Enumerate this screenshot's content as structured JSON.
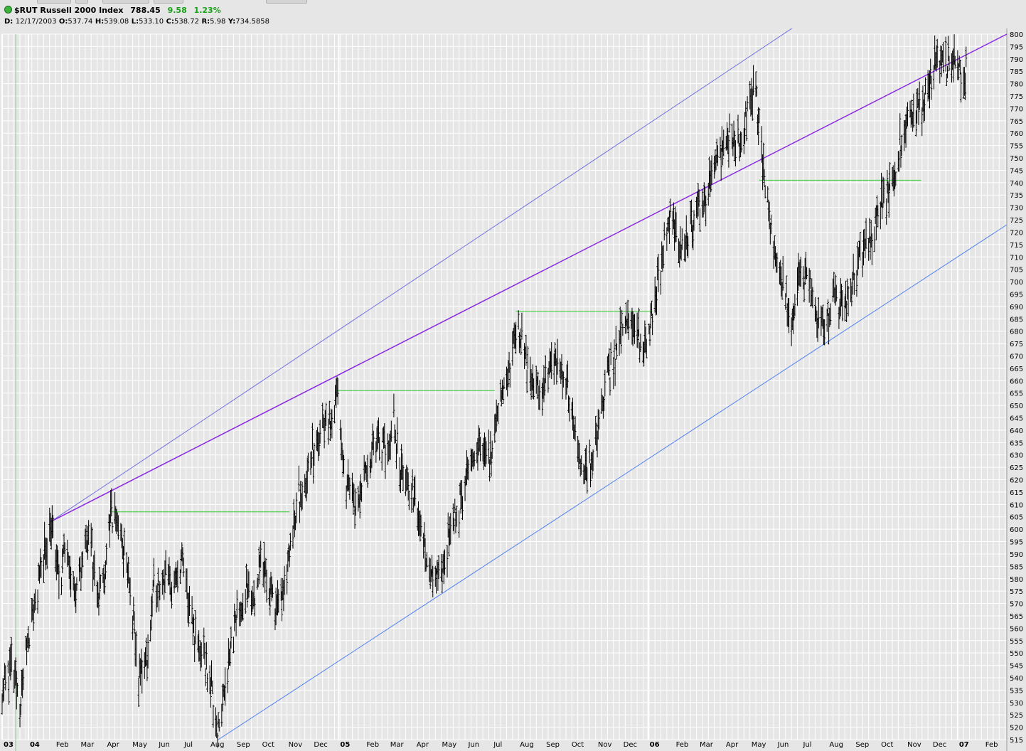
{
  "header": {
    "symbol": "$RUT",
    "name": "Russell 2000 Index",
    "last": "788.45",
    "change": "9.58",
    "change_pct": "1.23%"
  },
  "ohlc": {
    "date_label": "D:",
    "date": "12/17/2003",
    "open_label": "O:",
    "open": "537.74",
    "high_label": "H:",
    "high": "539.08",
    "low_label": "L:",
    "low": "533.10",
    "close_label": "C:",
    "close": "538.72",
    "range_label": "R:",
    "range": "5.98",
    "y_label": "Y:",
    "y": "734.5858"
  },
  "colors": {
    "background": "#e6e6e6",
    "grid": "#ffffff",
    "bars": "#000000",
    "upper_channel": "#7070e0",
    "resistance_line": "#8a2be2",
    "lower_channel": "#5080f0",
    "horizontal_levels": "#2ecc2e",
    "change_text": "#17a317",
    "crosshair": "#8fbf8f"
  },
  "chart_data": {
    "type": "ohlc",
    "title": "$RUT Russell 2000 Index",
    "ylim": [
      515,
      800
    ],
    "y_ticks": [
      515,
      520,
      525,
      530,
      535,
      540,
      545,
      550,
      555,
      560,
      565,
      570,
      575,
      580,
      585,
      590,
      595,
      600,
      605,
      610,
      615,
      620,
      625,
      630,
      635,
      640,
      645,
      650,
      655,
      660,
      665,
      670,
      675,
      680,
      685,
      690,
      695,
      700,
      705,
      710,
      715,
      720,
      725,
      730,
      735,
      740,
      745,
      750,
      755,
      760,
      765,
      770,
      775,
      780,
      785,
      790,
      795,
      800
    ],
    "x_range": [
      "2003-12-01",
      "2007-02-28"
    ],
    "x_ticks": [
      {
        "label": "03",
        "date": "2003-12-01",
        "year": true
      },
      {
        "label": "04",
        "date": "2004-01-01",
        "year": true
      },
      {
        "label": "Feb",
        "date": "2004-02-01"
      },
      {
        "label": "Mar",
        "date": "2004-03-01"
      },
      {
        "label": "Apr",
        "date": "2004-04-01"
      },
      {
        "label": "May",
        "date": "2004-05-01"
      },
      {
        "label": "Jun",
        "date": "2004-06-01"
      },
      {
        "label": "Jul",
        "date": "2004-07-01"
      },
      {
        "label": "Aug",
        "date": "2004-08-01"
      },
      {
        "label": "Sep",
        "date": "2004-09-01"
      },
      {
        "label": "Oct",
        "date": "2004-10-01"
      },
      {
        "label": "Nov",
        "date": "2004-11-01"
      },
      {
        "label": "Dec",
        "date": "2004-12-01"
      },
      {
        "label": "05",
        "date": "2005-01-01",
        "year": true
      },
      {
        "label": "Feb",
        "date": "2005-02-01"
      },
      {
        "label": "Mar",
        "date": "2005-03-01"
      },
      {
        "label": "Apr",
        "date": "2005-04-01"
      },
      {
        "label": "May",
        "date": "2005-05-01"
      },
      {
        "label": "Jun",
        "date": "2005-06-01"
      },
      {
        "label": "Jul",
        "date": "2005-07-01"
      },
      {
        "label": "Aug",
        "date": "2005-08-01"
      },
      {
        "label": "Sep",
        "date": "2005-09-01"
      },
      {
        "label": "Oct",
        "date": "2005-10-01"
      },
      {
        "label": "Nov",
        "date": "2005-11-01"
      },
      {
        "label": "Dec",
        "date": "2005-12-01"
      },
      {
        "label": "06",
        "date": "2006-01-01",
        "year": true
      },
      {
        "label": "Feb",
        "date": "2006-02-01"
      },
      {
        "label": "Mar",
        "date": "2006-03-01"
      },
      {
        "label": "Apr",
        "date": "2006-04-01"
      },
      {
        "label": "May",
        "date": "2006-05-01"
      },
      {
        "label": "Jun",
        "date": "2006-06-01"
      },
      {
        "label": "Jul",
        "date": "2006-07-01"
      },
      {
        "label": "Aug",
        "date": "2006-08-01"
      },
      {
        "label": "Sep",
        "date": "2006-09-01"
      },
      {
        "label": "Oct",
        "date": "2006-10-01"
      },
      {
        "label": "Nov",
        "date": "2006-11-01"
      },
      {
        "label": "Dec",
        "date": "2006-12-01"
      },
      {
        "label": "07",
        "date": "2007-01-01",
        "year": true
      },
      {
        "label": "Feb",
        "date": "2007-02-01"
      }
    ],
    "series": [
      {
        "name": "",
        "kind": "close-path",
        "points": [
          [
            "2003-12-01",
            535
          ],
          [
            "2003-12-12",
            545
          ],
          [
            "2003-12-22",
            530
          ],
          [
            "2004-01-02",
            560
          ],
          [
            "2004-01-12",
            575
          ],
          [
            "2004-01-22",
            595
          ],
          [
            "2004-01-27",
            603
          ],
          [
            "2004-02-06",
            580
          ],
          [
            "2004-02-16",
            595
          ],
          [
            "2004-02-26",
            570
          ],
          [
            "2004-03-05",
            590
          ],
          [
            "2004-03-12",
            600
          ],
          [
            "2004-03-22",
            575
          ],
          [
            "2004-03-30",
            580
          ],
          [
            "2004-04-06",
            603
          ],
          [
            "2004-04-14",
            605
          ],
          [
            "2004-04-26",
            585
          ],
          [
            "2004-05-10",
            540
          ],
          [
            "2004-05-20",
            548
          ],
          [
            "2004-05-28",
            575
          ],
          [
            "2004-06-10",
            582
          ],
          [
            "2004-06-20",
            575
          ],
          [
            "2004-06-30",
            588
          ],
          [
            "2004-07-10",
            565
          ],
          [
            "2004-07-22",
            550
          ],
          [
            "2004-08-02",
            540
          ],
          [
            "2004-08-12",
            518
          ],
          [
            "2004-08-22",
            545
          ],
          [
            "2004-09-01",
            560
          ],
          [
            "2004-09-12",
            575
          ],
          [
            "2004-09-22",
            570
          ],
          [
            "2004-10-01",
            588
          ],
          [
            "2004-10-12",
            575
          ],
          [
            "2004-10-22",
            568
          ],
          [
            "2004-11-01",
            585
          ],
          [
            "2004-11-12",
            610
          ],
          [
            "2004-11-22",
            620
          ],
          [
            "2004-12-02",
            630
          ],
          [
            "2004-12-12",
            640
          ],
          [
            "2004-12-22",
            645
          ],
          [
            "2004-12-30",
            652
          ],
          [
            "2005-01-06",
            625
          ],
          [
            "2005-01-16",
            615
          ],
          [
            "2005-01-26",
            610
          ],
          [
            "2005-02-06",
            630
          ],
          [
            "2005-02-16",
            635
          ],
          [
            "2005-02-26",
            630
          ],
          [
            "2005-03-07",
            642
          ],
          [
            "2005-03-17",
            620
          ],
          [
            "2005-03-28",
            615
          ],
          [
            "2005-04-08",
            600
          ],
          [
            "2005-04-18",
            585
          ],
          [
            "2005-04-28",
            578
          ],
          [
            "2005-05-08",
            590
          ],
          [
            "2005-05-18",
            605
          ],
          [
            "2005-05-28",
            615
          ],
          [
            "2005-06-08",
            628
          ],
          [
            "2005-06-20",
            635
          ],
          [
            "2005-06-30",
            630
          ],
          [
            "2005-07-10",
            648
          ],
          [
            "2005-07-20",
            665
          ],
          [
            "2005-08-01",
            682
          ],
          [
            "2005-08-08",
            672
          ],
          [
            "2005-08-18",
            658
          ],
          [
            "2005-08-28",
            655
          ],
          [
            "2005-09-07",
            665
          ],
          [
            "2005-09-17",
            668
          ],
          [
            "2005-09-27",
            660
          ],
          [
            "2005-10-07",
            640
          ],
          [
            "2005-10-17",
            620
          ],
          [
            "2005-10-27",
            630
          ],
          [
            "2005-11-07",
            650
          ],
          [
            "2005-11-17",
            665
          ],
          [
            "2005-11-27",
            675
          ],
          [
            "2005-12-07",
            685
          ],
          [
            "2005-12-17",
            680
          ],
          [
            "2005-12-27",
            672
          ],
          [
            "2006-01-06",
            690
          ],
          [
            "2006-01-16",
            705
          ],
          [
            "2006-01-26",
            725
          ],
          [
            "2006-02-06",
            715
          ],
          [
            "2006-02-16",
            720
          ],
          [
            "2006-02-26",
            728
          ],
          [
            "2006-03-08",
            732
          ],
          [
            "2006-03-18",
            745
          ],
          [
            "2006-03-28",
            752
          ],
          [
            "2006-04-07",
            760
          ],
          [
            "2006-04-17",
            755
          ],
          [
            "2006-04-27",
            768
          ],
          [
            "2006-05-06",
            780
          ],
          [
            "2006-05-12",
            765
          ],
          [
            "2006-05-20",
            735
          ],
          [
            "2006-05-30",
            712
          ],
          [
            "2006-06-09",
            700
          ],
          [
            "2006-06-19",
            680
          ],
          [
            "2006-06-29",
            705
          ],
          [
            "2006-07-09",
            702
          ],
          [
            "2006-07-19",
            685
          ],
          [
            "2006-07-29",
            680
          ],
          [
            "2006-08-08",
            692
          ],
          [
            "2006-08-18",
            688
          ],
          [
            "2006-08-28",
            700
          ],
          [
            "2006-09-07",
            710
          ],
          [
            "2006-09-17",
            715
          ],
          [
            "2006-09-27",
            725
          ],
          [
            "2006-10-07",
            735
          ],
          [
            "2006-10-17",
            742
          ],
          [
            "2006-10-27",
            758
          ],
          [
            "2006-11-06",
            765
          ],
          [
            "2006-11-16",
            770
          ],
          [
            "2006-11-26",
            775
          ],
          [
            "2006-12-06",
            790
          ],
          [
            "2006-12-16",
            785
          ],
          [
            "2006-12-26",
            792
          ],
          [
            "2007-01-05",
            782
          ],
          [
            "2007-01-12",
            788
          ]
        ]
      },
      {
        "name": "",
        "kind": "trendline",
        "color_key": "upper_channel",
        "from": [
          "2004-01-27",
          603
        ],
        "to": [
          "2006-12-15",
          843
        ]
      },
      {
        "name": "",
        "kind": "trendline",
        "color_key": "resistance_line",
        "from": [
          "2004-01-27",
          603
        ],
        "to": [
          "2007-02-28",
          800
        ]
      },
      {
        "name": "",
        "kind": "trendline",
        "color_key": "lower_channel",
        "from": [
          "2004-08-12",
          515
        ],
        "to": [
          "2007-02-28",
          723
        ]
      },
      {
        "name": "",
        "kind": "level",
        "color_key": "horizontal_levels",
        "y": 607,
        "from": "2004-04-08",
        "to": "2004-11-04"
      },
      {
        "name": "",
        "kind": "level",
        "color_key": "horizontal_levels",
        "y": 656,
        "from": "2004-12-30",
        "to": "2005-07-04"
      },
      {
        "name": "",
        "kind": "level",
        "color_key": "horizontal_levels",
        "y": 688,
        "from": "2005-07-29",
        "to": "2006-01-06"
      },
      {
        "name": "",
        "kind": "level",
        "color_key": "horizontal_levels",
        "y": 741,
        "from": "2006-05-12",
        "to": "2006-11-19"
      }
    ],
    "grid": true,
    "y_axis_position": "right"
  }
}
